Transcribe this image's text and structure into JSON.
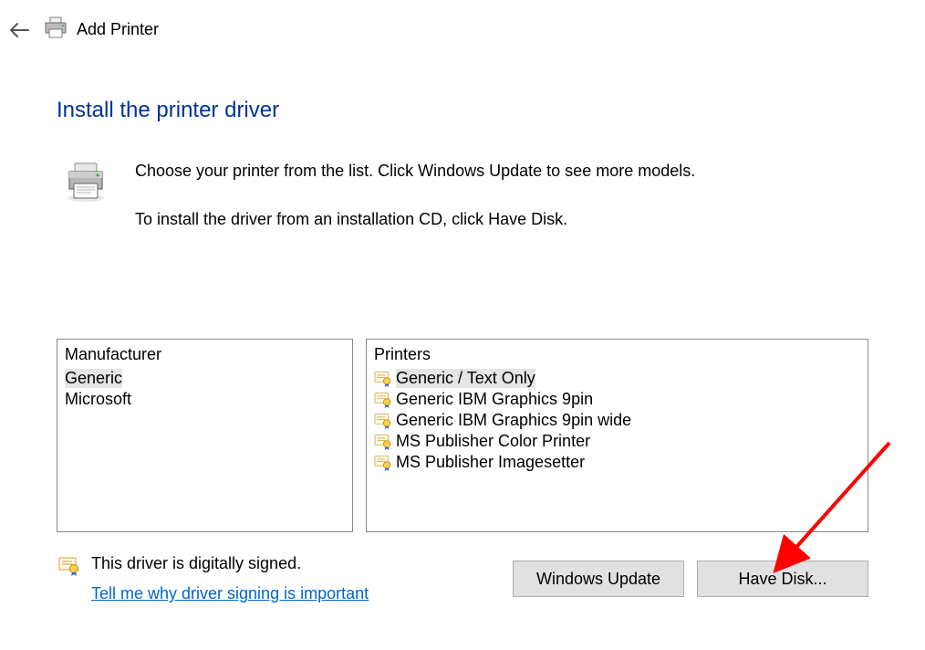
{
  "header": {
    "title": "Add Printer"
  },
  "heading": "Install the printer driver",
  "instructions": {
    "line1": "Choose your printer from the list. Click Windows Update to see more models.",
    "line2": "To install the driver from an installation CD, click Have Disk."
  },
  "manufacturer_list": {
    "header": "Manufacturer",
    "items": [
      "Generic",
      "Microsoft"
    ],
    "selected_index": 0
  },
  "printers_list": {
    "header": "Printers",
    "items": [
      "Generic / Text Only",
      "Generic IBM Graphics 9pin",
      "Generic IBM Graphics 9pin wide",
      "MS Publisher Color Printer",
      "MS Publisher Imagesetter"
    ],
    "selected_index": 0
  },
  "signed": {
    "text": "This driver is digitally signed.",
    "link": "Tell me why driver signing is important"
  },
  "buttons": {
    "windows_update": "Windows Update",
    "have_disk": "Have Disk..."
  }
}
